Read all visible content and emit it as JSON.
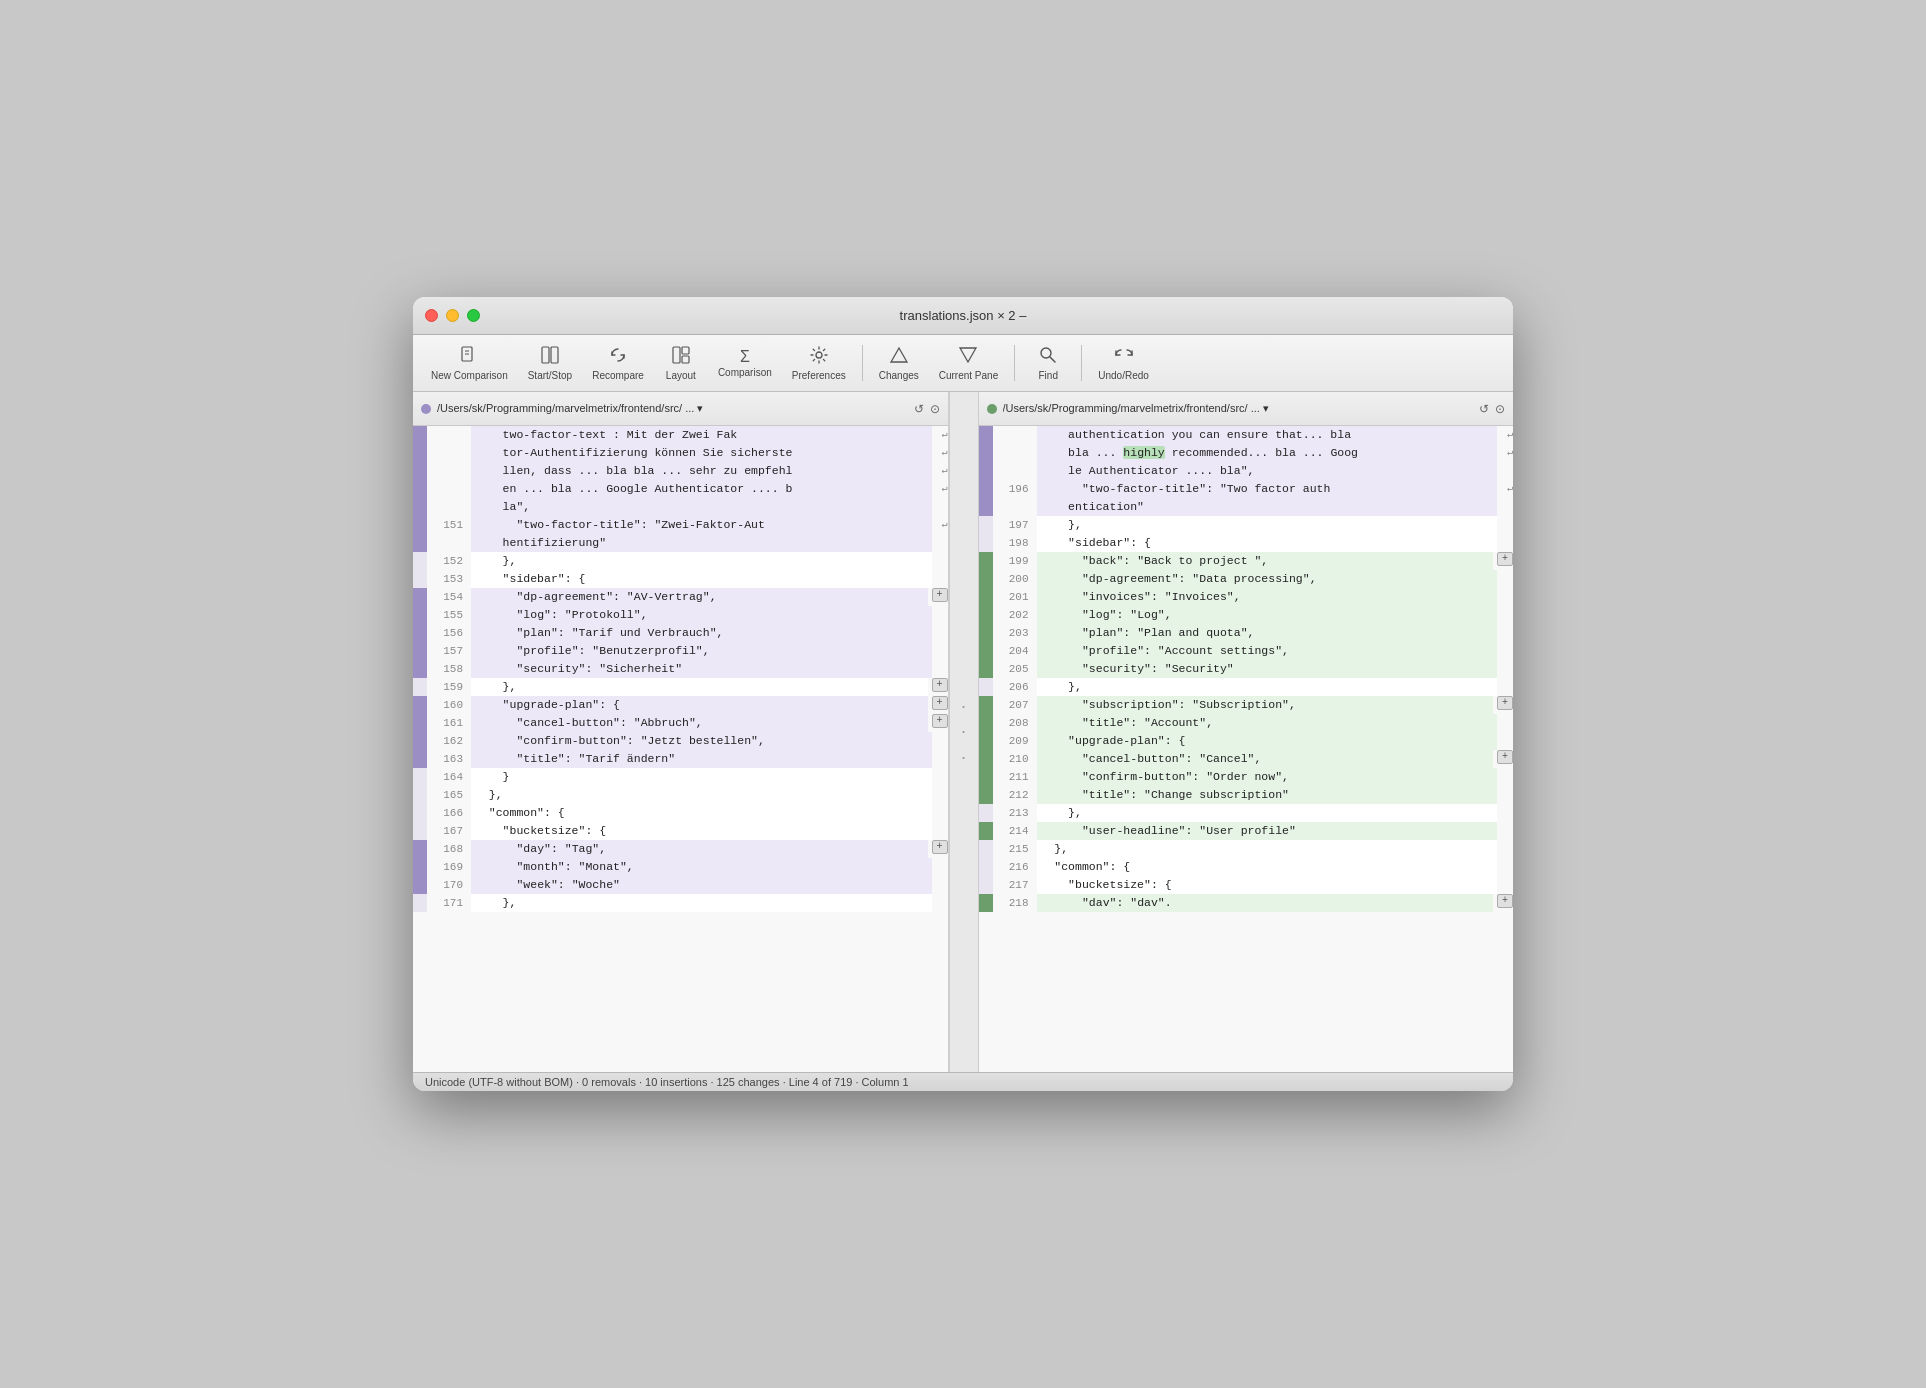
{
  "window": {
    "title": "translations.json × 2 –"
  },
  "toolbar": {
    "items": [
      {
        "id": "new-comparison",
        "icon": "📄",
        "label": "New Comparison"
      },
      {
        "id": "start-stop",
        "icon": "⏯",
        "label": "Start/Stop"
      },
      {
        "id": "recompare",
        "icon": "↺",
        "label": "Recompare"
      },
      {
        "id": "layout",
        "icon": "⊞",
        "label": "Layout"
      },
      {
        "id": "comparison",
        "icon": "Σ",
        "label": "Comparison"
      },
      {
        "id": "preferences",
        "icon": "⚙",
        "label": "Preferences"
      },
      {
        "id": "changes",
        "icon": "△",
        "label": "Changes"
      },
      {
        "id": "current-pane",
        "icon": "▽",
        "label": "Current Pane"
      },
      {
        "id": "find",
        "icon": "🔍",
        "label": "Find"
      },
      {
        "id": "undo-redo",
        "icon": "↩↪",
        "label": "Undo/Redo"
      }
    ]
  },
  "left_pane": {
    "path": "/Users/sk/Programming/marvelmetrix/frontend/src/ ... ▾",
    "lines": [
      {
        "num": "",
        "gutter": "neutral",
        "bg": "neutral",
        "content": "    two-factor-text : Mit der Zwei Fak",
        "wrap": true
      },
      {
        "num": "",
        "gutter": "changed",
        "bg": "changed",
        "content": "    tor-Authentifizierung können Sie sicherste",
        "wrap": true
      },
      {
        "num": "",
        "gutter": "changed",
        "bg": "changed",
        "content": "    llen, dass ... bla bla ... sehr zu empfehl",
        "wrap": true
      },
      {
        "num": "",
        "gutter": "changed",
        "bg": "changed",
        "content": "    en ... bla ... Google Authenticator .... b",
        "wrap": true
      },
      {
        "num": "",
        "gutter": "changed",
        "bg": "changed",
        "content": "    la\",",
        "wrap": false
      },
      {
        "num": "151",
        "gutter": "changed",
        "bg": "changed",
        "content": "      \"two-factor-title\": \"Zwei-Faktor-Aut",
        "wrap": true
      },
      {
        "num": "",
        "gutter": "changed",
        "bg": "changed",
        "content": "    hentifizierung\"",
        "wrap": false
      },
      {
        "num": "152",
        "gutter": "neutral",
        "bg": "white",
        "content": "    },",
        "wrap": false
      },
      {
        "num": "153",
        "gutter": "neutral",
        "bg": "white",
        "content": "    \"sidebar\": {",
        "wrap": false
      },
      {
        "num": "154",
        "gutter": "changed",
        "bg": "changed",
        "content": "      \"dp-agreement\": \"AV-Vertrag\",",
        "wrap": false,
        "plus": true
      },
      {
        "num": "155",
        "gutter": "changed",
        "bg": "changed",
        "content": "      \"log\": \"Protokoll\",",
        "wrap": false
      },
      {
        "num": "156",
        "gutter": "changed",
        "bg": "changed",
        "content": "      \"plan\": \"Tarif und Verbrauch\",",
        "wrap": false
      },
      {
        "num": "157",
        "gutter": "changed",
        "bg": "changed",
        "content": "      \"profile\": \"Benutzerprofil\",",
        "wrap": false
      },
      {
        "num": "158",
        "gutter": "changed",
        "bg": "changed",
        "content": "      \"security\": \"Sicherheit\"",
        "wrap": false
      },
      {
        "num": "159",
        "gutter": "neutral",
        "bg": "white",
        "content": "    },",
        "wrap": false,
        "plus": true
      },
      {
        "num": "160",
        "gutter": "changed",
        "bg": "changed",
        "content": "    \"upgrade-plan\": {",
        "wrap": false,
        "plus": true
      },
      {
        "num": "161",
        "gutter": "changed",
        "bg": "changed",
        "content": "      \"cancel-button\": \"Abbruch\",",
        "wrap": false,
        "plus": true
      },
      {
        "num": "162",
        "gutter": "changed",
        "bg": "changed",
        "content": "      \"confirm-button\": \"Jetzt bestellen\",",
        "wrap": false
      },
      {
        "num": "163",
        "gutter": "changed",
        "bg": "changed",
        "content": "      \"title\": \"Tarif ändern\"",
        "wrap": false
      },
      {
        "num": "164",
        "gutter": "neutral",
        "bg": "white",
        "content": "    }",
        "wrap": false
      },
      {
        "num": "165",
        "gutter": "neutral",
        "bg": "white",
        "content": "  },",
        "wrap": false
      },
      {
        "num": "166",
        "gutter": "neutral",
        "bg": "white",
        "content": "  \"common\": {",
        "wrap": false
      },
      {
        "num": "167",
        "gutter": "neutral",
        "bg": "white",
        "content": "    \"bucketsize\": {",
        "wrap": false
      },
      {
        "num": "168",
        "gutter": "changed",
        "bg": "changed",
        "content": "      \"day\": \"Tag\",",
        "wrap": false,
        "plus": true
      },
      {
        "num": "169",
        "gutter": "changed",
        "bg": "changed",
        "content": "      \"month\": \"Monat\",",
        "wrap": false
      },
      {
        "num": "170",
        "gutter": "changed",
        "bg": "changed",
        "content": "      \"week\": \"Woche\"",
        "wrap": false
      },
      {
        "num": "171",
        "gutter": "neutral",
        "bg": "white",
        "content": "    },",
        "wrap": false
      }
    ]
  },
  "right_pane": {
    "path": "/Users/sk/Programming/marvelmetrix/frontend/src/ ... ▾",
    "lines": [
      {
        "num": "",
        "gutter": "neutral",
        "bg": "neutral",
        "content": "    authentication you can ensure that... bla",
        "wrap": true
      },
      {
        "num": "",
        "gutter": "changed",
        "bg": "changed",
        "content": "    bla ... highly recommended... bla ... Goog",
        "wrap": true
      },
      {
        "num": "",
        "gutter": "changed",
        "bg": "changed",
        "content": "    le Authenticator .... bla\",",
        "wrap": false
      },
      {
        "num": "196",
        "gutter": "changed",
        "bg": "changed",
        "content": "      \"two-factor-title\": \"Two factor auth",
        "wrap": true
      },
      {
        "num": "",
        "gutter": "changed",
        "bg": "changed",
        "content": "    entication\"",
        "wrap": false
      },
      {
        "num": "197",
        "gutter": "neutral",
        "bg": "white",
        "content": "    },",
        "wrap": false
      },
      {
        "num": "198",
        "gutter": "neutral",
        "bg": "white",
        "content": "    \"sidebar\": {",
        "wrap": false
      },
      {
        "num": "199",
        "gutter": "added",
        "bg": "added",
        "content": "      \"back\": \"Back to project \",",
        "wrap": false,
        "plus": true
      },
      {
        "num": "200",
        "gutter": "added",
        "bg": "added",
        "content": "      \"dp-agreement\": \"Data processing\",",
        "wrap": false
      },
      {
        "num": "201",
        "gutter": "added",
        "bg": "added",
        "content": "      \"invoices\": \"Invoices\",",
        "wrap": false
      },
      {
        "num": "202",
        "gutter": "added",
        "bg": "added",
        "content": "      \"log\": \"Log\",",
        "wrap": false
      },
      {
        "num": "203",
        "gutter": "added",
        "bg": "added",
        "content": "      \"plan\": \"Plan and quota\",",
        "wrap": false
      },
      {
        "num": "204",
        "gutter": "added",
        "bg": "added",
        "content": "      \"profile\": \"Account settings\",",
        "wrap": false
      },
      {
        "num": "205",
        "gutter": "added",
        "bg": "added",
        "content": "      \"security\": \"Security\"",
        "wrap": false
      },
      {
        "num": "206",
        "gutter": "neutral",
        "bg": "white",
        "content": "    },",
        "wrap": false
      },
      {
        "num": "207",
        "gutter": "added",
        "bg": "added",
        "content": "      \"subscription\": \"Subscription\",",
        "wrap": false,
        "plus": true
      },
      {
        "num": "208",
        "gutter": "added",
        "bg": "added",
        "content": "      \"title\": \"Account\",",
        "wrap": false
      },
      {
        "num": "209",
        "gutter": "added",
        "bg": "added",
        "content": "    \"upgrade-plan\": {",
        "wrap": false
      },
      {
        "num": "210",
        "gutter": "added",
        "bg": "added",
        "content": "      \"cancel-button\": \"Cancel\",",
        "wrap": false,
        "plus": true
      },
      {
        "num": "211",
        "gutter": "added",
        "bg": "added",
        "content": "      \"confirm-button\": \"Order now\",",
        "wrap": false
      },
      {
        "num": "212",
        "gutter": "added",
        "bg": "added",
        "content": "      \"title\": \"Change subscription\"",
        "wrap": false
      },
      {
        "num": "213",
        "gutter": "neutral",
        "bg": "white",
        "content": "    },",
        "wrap": false
      },
      {
        "num": "214",
        "gutter": "added",
        "bg": "added",
        "content": "      \"user-headline\": \"User profile\"",
        "wrap": false
      },
      {
        "num": "215",
        "gutter": "neutral",
        "bg": "white",
        "content": "  },",
        "wrap": false
      },
      {
        "num": "216",
        "gutter": "neutral",
        "bg": "white",
        "content": "  \"common\": {",
        "wrap": false
      },
      {
        "num": "217",
        "gutter": "neutral",
        "bg": "white",
        "content": "    \"bucketsize\": {",
        "wrap": false
      },
      {
        "num": "218",
        "gutter": "added",
        "bg": "added",
        "content": "      \"dav\": \"dav\".",
        "wrap": false,
        "plus": true
      }
    ]
  },
  "status_bar": {
    "text": "Unicode (UTF-8 without BOM) · 0 removals · 10 insertions · 125 changes · Line 4 of 719 · Column 1"
  }
}
